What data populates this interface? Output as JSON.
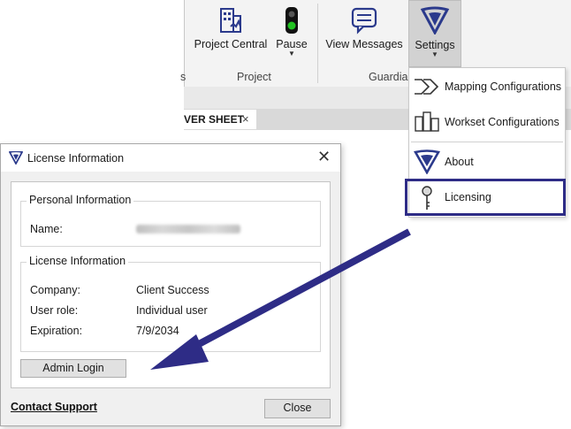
{
  "ribbon": {
    "buttons": {
      "project_central": "Project Central",
      "pause": "Pause",
      "view_messages": "View Messages",
      "settings": "Settings"
    },
    "groups": {
      "project": "Project",
      "guardian": "Guardia"
    },
    "partial_left_label": "s"
  },
  "tab": {
    "label": "VER SHEET",
    "close": "×"
  },
  "menu": {
    "items": [
      {
        "label": "Mapping Configurations",
        "icon": "mapping-icon"
      },
      {
        "label": "Workset Configurations",
        "icon": "workset-icon"
      },
      {
        "label": "About",
        "icon": "guardian-logo-icon"
      },
      {
        "label": "Licensing",
        "icon": "key-icon"
      }
    ]
  },
  "dialog": {
    "title": "License Information",
    "close": "✕",
    "personal": {
      "heading": "Personal Information",
      "name_label": "Name:"
    },
    "license": {
      "heading": "License Information",
      "company_label": "Company:",
      "company_value": "Client Success",
      "role_label": "User role:",
      "role_value": "Individual user",
      "expiration_label": "Expiration:",
      "expiration_value": "7/9/2034"
    },
    "admin_login": "Admin Login",
    "contact_support": "Contact Support",
    "close_button": "Close"
  },
  "colors": {
    "accent": "#2e2c86",
    "brand_logo": "#2b3a8c"
  }
}
